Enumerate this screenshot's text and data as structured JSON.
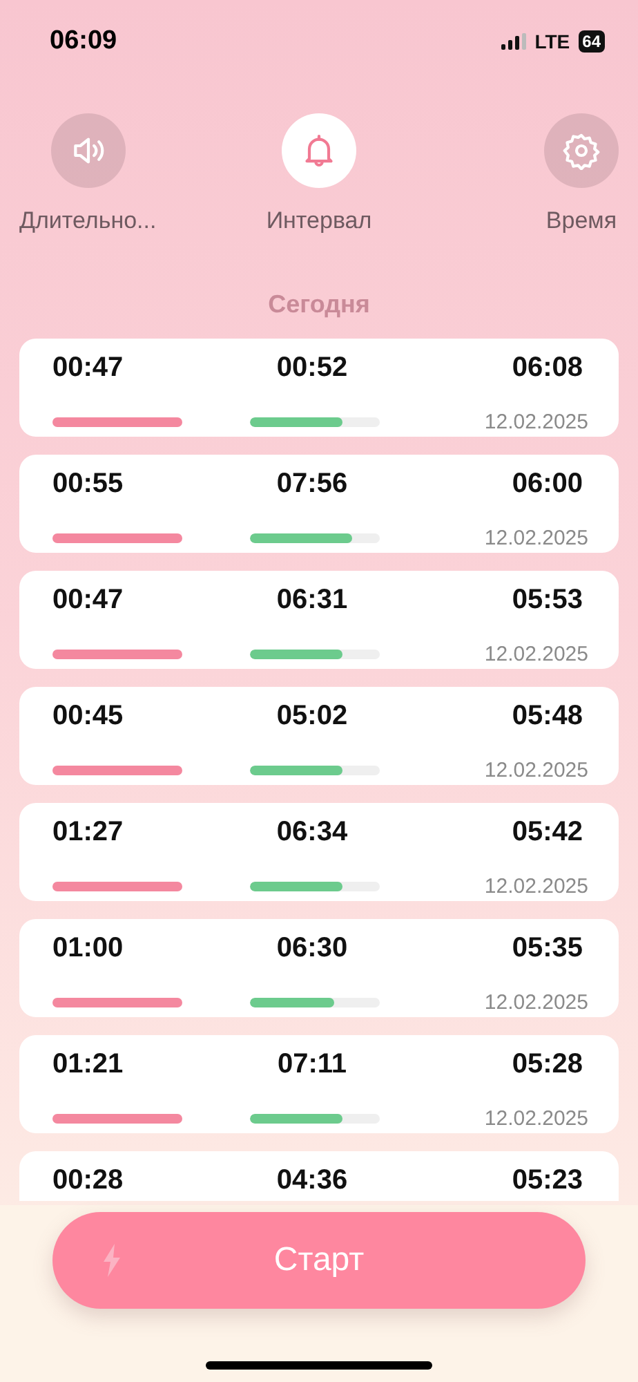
{
  "status_bar": {
    "time": "06:09",
    "network": "LTE",
    "battery": "64"
  },
  "tabs": [
    {
      "kind": "sound",
      "label": "Длительно...",
      "selected": false
    },
    {
      "kind": "bell",
      "label": "Интервал",
      "selected": true
    },
    {
      "kind": "gear",
      "label": "Время",
      "selected": false
    }
  ],
  "section_title": "Сегодня",
  "sessions": [
    {
      "duration": "00:47",
      "interval": "00:52",
      "time": "06:08",
      "level": 0.71,
      "date": "12.02.2025"
    },
    {
      "duration": "00:55",
      "interval": "07:56",
      "time": "06:00",
      "level": 0.79,
      "date": "12.02.2025"
    },
    {
      "duration": "00:47",
      "interval": "06:31",
      "time": "05:53",
      "level": 0.71,
      "date": "12.02.2025"
    },
    {
      "duration": "00:45",
      "interval": "05:02",
      "time": "05:48",
      "level": 0.71,
      "date": "12.02.2025"
    },
    {
      "duration": "01:27",
      "interval": "06:34",
      "time": "05:42",
      "level": 0.71,
      "date": "12.02.2025"
    },
    {
      "duration": "01:00",
      "interval": "06:30",
      "time": "05:35",
      "level": 0.65,
      "date": "12.02.2025"
    },
    {
      "duration": "01:21",
      "interval": "07:11",
      "time": "05:28",
      "level": 0.71,
      "date": "12.02.2025"
    },
    {
      "duration": "00:28",
      "interval": "04:36",
      "time": "05:23"
    }
  ],
  "start_button": {
    "label": "Старт"
  }
}
